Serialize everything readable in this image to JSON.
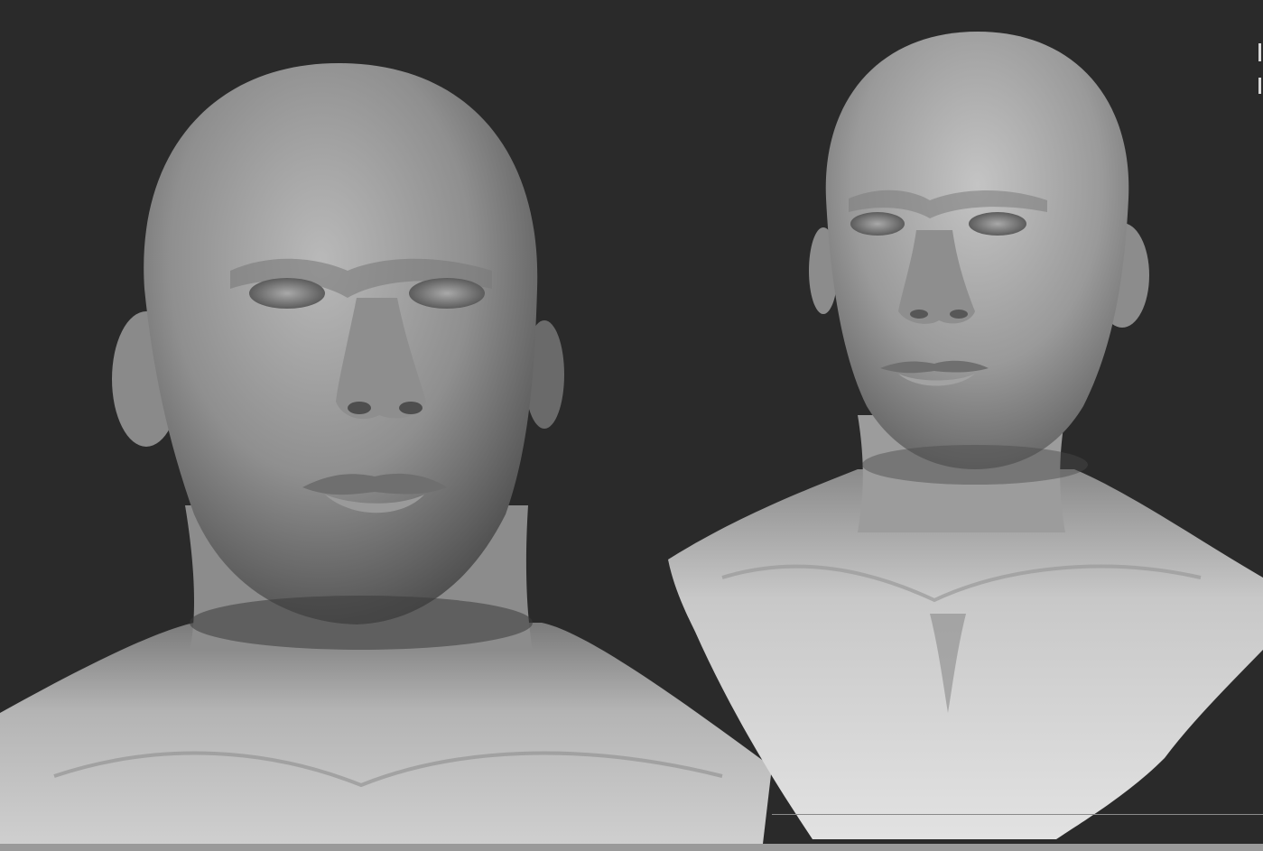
{
  "viewport": {
    "background_color": "#2a2a2a",
    "bottom_bar_color": "#9a9a9a"
  },
  "models": [
    {
      "id": "bust-front-closeup",
      "description_name": "head-closeup-model"
    },
    {
      "id": "bust-three-quarter",
      "description_name": "bust-model"
    }
  ]
}
